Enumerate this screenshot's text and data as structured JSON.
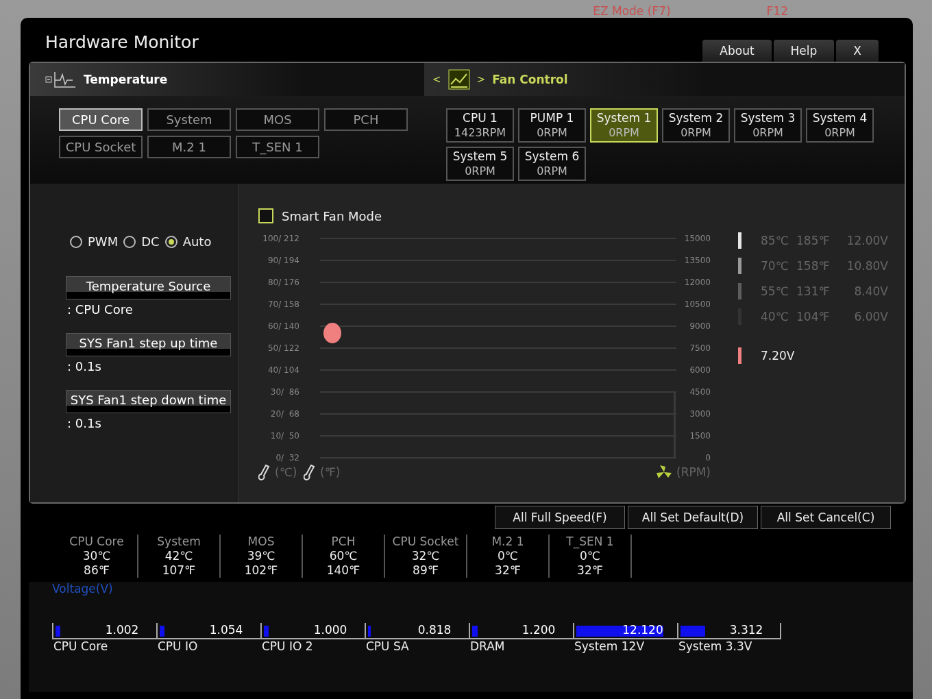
{
  "backdrop": {
    "hint": "EZ Mode (F7)",
    "key": "F12"
  },
  "window": {
    "title": "Hardware Monitor",
    "buttons": [
      "About",
      "Help",
      "X"
    ]
  },
  "temperature": {
    "title": "Temperature",
    "sources": [
      {
        "label": "CPU Core",
        "selected": true
      },
      {
        "label": "System",
        "selected": false
      },
      {
        "label": "MOS",
        "selected": false
      },
      {
        "label": "PCH",
        "selected": false
      },
      {
        "label": "CPU Socket",
        "selected": false
      },
      {
        "label": "M.2 1",
        "selected": false
      },
      {
        "label": "T_SEN 1",
        "selected": false
      }
    ]
  },
  "fan_control": {
    "title": "Fan Control",
    "prev": "<",
    "next": ">",
    "fans": [
      {
        "name": "CPU 1",
        "speed": "1423RPM",
        "selected": false
      },
      {
        "name": "PUMP 1",
        "speed": "0RPM",
        "selected": false
      },
      {
        "name": "System 1",
        "speed": "0RPM",
        "selected": true
      },
      {
        "name": "System 2",
        "speed": "0RPM",
        "selected": false
      },
      {
        "name": "System 3",
        "speed": "0RPM",
        "selected": false
      },
      {
        "name": "System 4",
        "speed": "0RPM",
        "selected": false
      },
      {
        "name": "System 5",
        "speed": "0RPM",
        "selected": false
      },
      {
        "name": "System 6",
        "speed": "0RPM",
        "selected": false
      }
    ]
  },
  "mode": {
    "options": [
      {
        "label": "PWM",
        "selected": false
      },
      {
        "label": "DC",
        "selected": false
      },
      {
        "label": "Auto",
        "selected": true
      }
    ]
  },
  "settings": [
    {
      "label": "Temperature Source",
      "value": ": CPU Core"
    },
    {
      "label": "SYS Fan1 step up time",
      "value": ": 0.1s"
    },
    {
      "label": "SYS Fan1 step down time",
      "value": ": 0.1s"
    }
  ],
  "smart_fan": {
    "label": "Smart Fan Mode",
    "checked": false
  },
  "fan_curve": {
    "temp_ticks": [
      "100/ 212",
      "90/ 194",
      "80/ 176",
      "70/ 158",
      "60/ 140",
      "50/ 122",
      "40/ 104",
      "30/  86",
      "20/  68",
      "10/  50",
      "0/  32"
    ],
    "rpm_ticks": [
      "15000",
      "13500",
      "12000",
      "10500",
      "9000",
      "7500",
      "6000",
      "4500",
      "3000",
      "1500",
      "0"
    ],
    "celsius_label": "(℃)",
    "fahrenheit_label": "(℉)",
    "rpm_label": "(RPM)"
  },
  "legend": [
    {
      "celsius": "85℃",
      "fahrenheit": "185℉",
      "voltage": "12.00V",
      "color": "#e6e6e6"
    },
    {
      "celsius": "70℃",
      "fahrenheit": "158℉",
      "voltage": "10.80V",
      "color": "#9a9a9a"
    },
    {
      "celsius": "55℃",
      "fahrenheit": "131℉",
      "voltage": "8.40V",
      "color": "#5e5e5e"
    },
    {
      "celsius": "40℃",
      "fahrenheit": "104℉",
      "voltage": "6.00V",
      "color": "#333333"
    }
  ],
  "current": {
    "voltage": "7.20V",
    "color": "#f08080"
  },
  "actions": [
    "All Full Speed(F)",
    "All Set Default(D)",
    "All Set Cancel(C)"
  ],
  "readings": [
    {
      "name": "CPU Core",
      "celsius": "30℃",
      "fahrenheit": "86℉"
    },
    {
      "name": "System",
      "celsius": "42℃",
      "fahrenheit": "107℉"
    },
    {
      "name": "MOS",
      "celsius": "39℃",
      "fahrenheit": "102℉"
    },
    {
      "name": "PCH",
      "celsius": "60℃",
      "fahrenheit": "140℉"
    },
    {
      "name": "CPU Socket",
      "celsius": "32℃",
      "fahrenheit": "89℉"
    },
    {
      "name": "M.2 1",
      "celsius": "0℃",
      "fahrenheit": "32℉"
    },
    {
      "name": "T_SEN 1",
      "celsius": "0℃",
      "fahrenheit": "32℉"
    }
  ],
  "voltage": {
    "title": "Voltage(V)",
    "rails": [
      {
        "name": "CPU Core",
        "value": "1.002",
        "level": 0.07
      },
      {
        "name": "CPU IO",
        "value": "1.054",
        "level": 0.07
      },
      {
        "name": "CPU IO 2",
        "value": "1.000",
        "level": 0.07
      },
      {
        "name": "CPU SA",
        "value": "0.818",
        "level": 0.05
      },
      {
        "name": "DRAM",
        "value": "1.200",
        "level": 0.08
      },
      {
        "name": "System 12V",
        "value": "12.120",
        "level": 0.87
      },
      {
        "name": "System 3.3V",
        "value": "3.312",
        "level": 0.27
      }
    ]
  }
}
